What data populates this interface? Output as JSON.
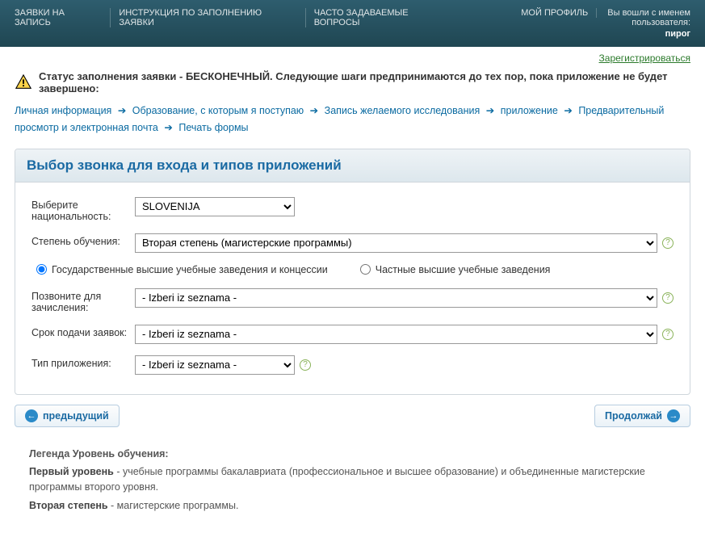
{
  "topnav": {
    "links": [
      "ЗАЯВКИ НА ЗАПИСЬ",
      "ИНСТРУКЦИЯ ПО ЗАПОЛНЕНИЮ ЗАЯВКИ",
      "ЧАСТО ЗАДАВАЕМЫЕ ВОПРОСЫ"
    ],
    "profile": "МОЙ ПРОФИЛЬ",
    "logged_as_label": "Вы вошли с именем пользователя:",
    "username": "пирог"
  },
  "register_link": "Зарегистрироваться",
  "status": {
    "text": "Статус заполнения заявки - БЕСКОНЕЧНЫЙ. Следующие шаги предпринимаются до тех пор, пока приложение не будет завершено:"
  },
  "breadcrumb": [
    "Личная информация",
    "Образование, с которым я поступаю",
    "Запись желаемого исследования",
    "приложение",
    "Предварительный просмотр и электронная почта",
    "Печать формы"
  ],
  "panel": {
    "title": "Выбор звонка для входа и типов приложений",
    "nationality_label": "Выберите национальность:",
    "nationality_value": "SLOVENIJA",
    "level_label": "Степень обучения:",
    "level_value": "Вторая степень (магистерские программы)",
    "radios": {
      "state": "Государственные высшие учебные заведения и концессии",
      "private": "Частные высшие учебные заведения"
    },
    "call_label": "Позвоните для зачисления:",
    "deadline_label": "Срок подачи заявок:",
    "apptype_label": "Тип приложения:",
    "placeholder_option": "- Izberi iz seznama -"
  },
  "nav": {
    "prev": "предыдущий",
    "next": "Продолжай"
  },
  "legend": {
    "title": "Легенда Уровень обучения:",
    "line1_bold": "Первый уровень",
    "line1_rest": " - учебные программы бакалавриата (профессиональное и высшее образование) и объединенные магистерские программы второго уровня.",
    "line2_bold": "Вторая степень",
    "line2_rest": " - магистерские программы."
  }
}
